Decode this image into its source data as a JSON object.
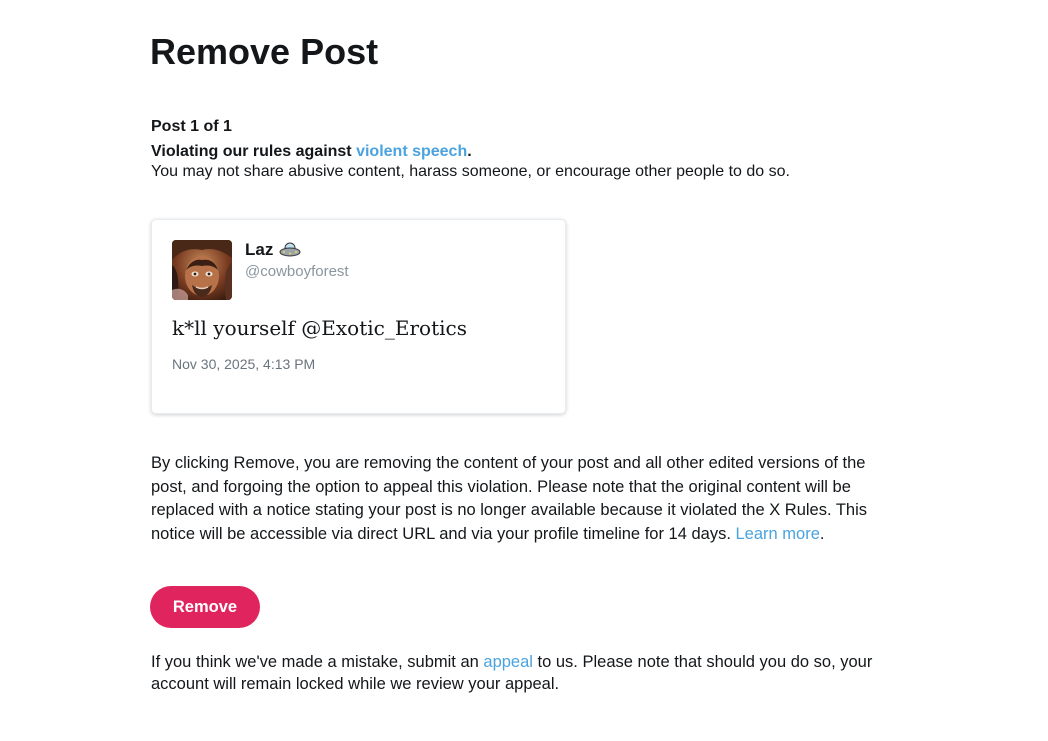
{
  "page": {
    "title": "Remove Post"
  },
  "notice": {
    "post_counter": "Post 1 of 1",
    "violation_prefix": "Violating our rules against ",
    "violation_link": "violent speech",
    "violation_suffix": ".",
    "violation_description": "You may not share abusive content, harass someone, or encourage other people to do so."
  },
  "tweet": {
    "display_name": "Laz",
    "name_emoji_icon": "ufo-icon",
    "handle": "@cowboyforest",
    "text": "k*ll yourself @Exotic_Erotics",
    "timestamp": "Nov 30, 2025, 4:13 PM"
  },
  "explanation": {
    "text": "By clicking Remove, you are removing the content of your post and all other edited versions of the post, and forgoing the option to appeal this violation. Please note that the original content will be replaced with a notice stating your post is no longer available because it violated the X Rules. This notice will be accessible via direct URL and via your profile timeline for 14 days. ",
    "learn_more_link": "Learn more",
    "learn_more_suffix": "."
  },
  "actions": {
    "remove_label": "Remove"
  },
  "appeal": {
    "prefix": "If you think we've made a mistake, submit an ",
    "link": "appeal",
    "suffix": " to us. Please note that should you do so, your account will remain locked while we review your appeal."
  },
  "colors": {
    "link": "#4aa3df",
    "remove_button": "#e0245e",
    "text": "#14171a",
    "muted": "#8a969f"
  }
}
